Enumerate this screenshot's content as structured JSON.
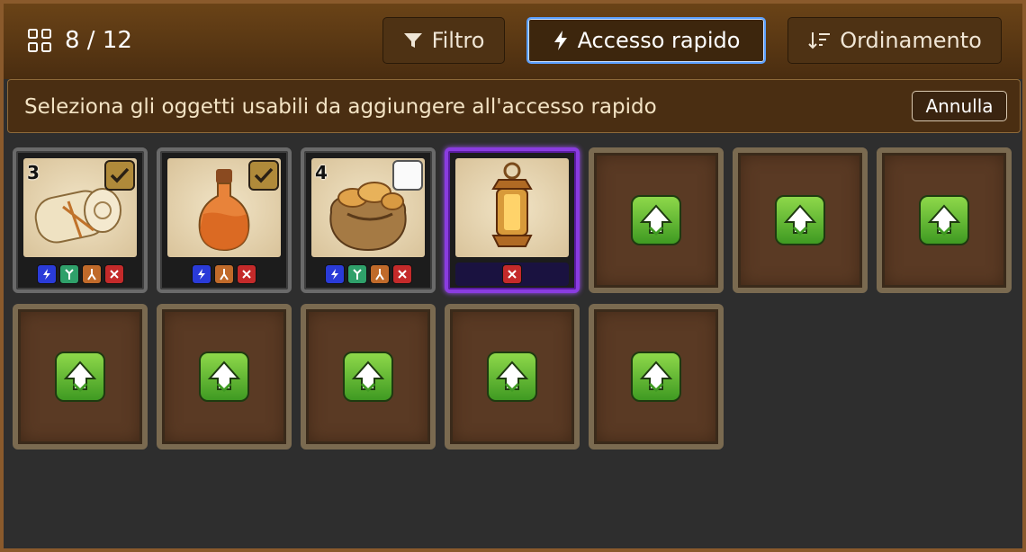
{
  "header": {
    "count": "8 / 12",
    "buttons": {
      "filter": "Filtro",
      "quick_access": "Accesso rapido",
      "sort": "Ordinamento"
    }
  },
  "banner": {
    "text": "Seleziona gli oggetti usabili da aggiungere all'accesso rapido",
    "cancel": "Annulla"
  },
  "items": [
    {
      "name": "bandage-roll",
      "qty": "3",
      "checked": true,
      "tags": [
        "blue",
        "green",
        "orange",
        "red"
      ]
    },
    {
      "name": "potion-bottle",
      "qty": "",
      "checked": true,
      "tags": [
        "blue",
        "orange",
        "red"
      ]
    },
    {
      "name": "bread-sack",
      "qty": "4",
      "checked": false,
      "tags": [
        "blue",
        "green",
        "orange",
        "red"
      ]
    },
    {
      "name": "lantern",
      "qty": "",
      "checked": null,
      "tags": [
        "red"
      ],
      "rarity": "purple"
    }
  ],
  "empty_slots": 8
}
